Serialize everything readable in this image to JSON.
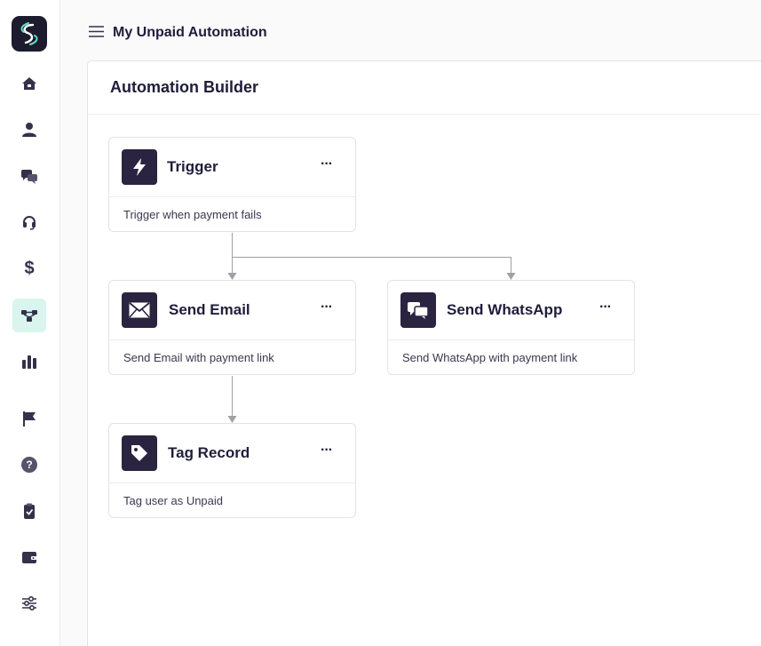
{
  "header": {
    "title": "My Unpaid Automation"
  },
  "sidebar": {
    "items": [
      {
        "name": "home-icon"
      },
      {
        "name": "user-icon"
      },
      {
        "name": "chat-icon"
      },
      {
        "name": "headset-icon"
      },
      {
        "name": "dollar-icon",
        "label": "$"
      },
      {
        "name": "workflow-icon",
        "active": true
      },
      {
        "name": "bar-chart-icon"
      },
      {
        "name": "flag-icon"
      },
      {
        "name": "help-icon",
        "label": "?"
      },
      {
        "name": "clipboard-check-icon"
      },
      {
        "name": "wallet-icon"
      },
      {
        "name": "sliders-icon"
      }
    ]
  },
  "panel": {
    "title": "Automation Builder"
  },
  "nodes": [
    {
      "id": "trigger",
      "title": "Trigger",
      "description": "Trigger when payment fails",
      "icon": "bolt-icon",
      "menu": "···"
    },
    {
      "id": "send-email",
      "title": "Send Email",
      "description": "Send Email with payment link",
      "icon": "envelope-icon",
      "menu": "···"
    },
    {
      "id": "send-whatsapp",
      "title": "Send WhatsApp",
      "description": "Send WhatsApp with payment link",
      "icon": "chat-bubbles-icon",
      "menu": "···"
    },
    {
      "id": "tag-record",
      "title": "Tag Record",
      "description": "Tag user as Unpaid",
      "icon": "tag-icon",
      "menu": "···"
    }
  ],
  "colors": {
    "accent": "#2a2440",
    "active_nav": "#d9f5ee",
    "connector": "#a0a0a8"
  }
}
